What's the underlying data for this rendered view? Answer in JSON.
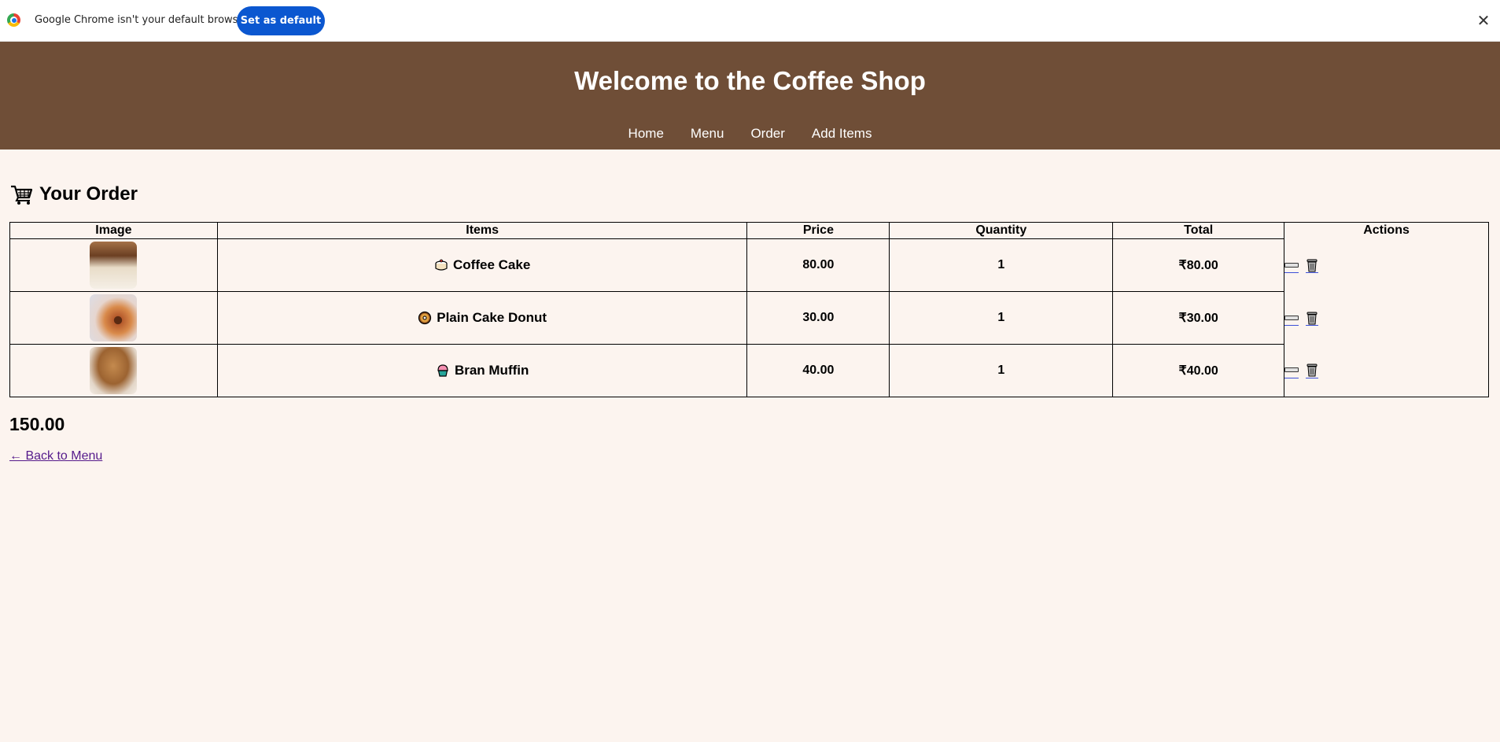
{
  "infobar": {
    "message": "Google Chrome isn't your default browser",
    "button_label": "Set as default",
    "close_glyph": "✕"
  },
  "header": {
    "title": "Welcome to the Coffee Shop",
    "nav": [
      "Home",
      "Menu",
      "Order",
      "Add Items"
    ],
    "background_color": "#6f4e37"
  },
  "order": {
    "heading": "Your Order",
    "columns": [
      "Image",
      "Items",
      "Price",
      "Quantity",
      "Total",
      "Actions"
    ],
    "rows": [
      {
        "item": "Coffee Cake",
        "icon": "cake-slice-icon",
        "price": "80.00",
        "quantity": "1",
        "total": "₹80.00"
      },
      {
        "item": "Plain Cake Donut",
        "icon": "donut-icon",
        "price": "30.00",
        "quantity": "1",
        "total": "₹30.00"
      },
      {
        "item": "Bran Muffin",
        "icon": "cupcake-icon",
        "price": "40.00",
        "quantity": "1",
        "total": "₹40.00"
      }
    ],
    "grand_total": "150.00",
    "back_link": "← Back to Menu"
  },
  "colors": {
    "page_background": "#fcf4ef",
    "primary_button": "#0b57d0"
  }
}
